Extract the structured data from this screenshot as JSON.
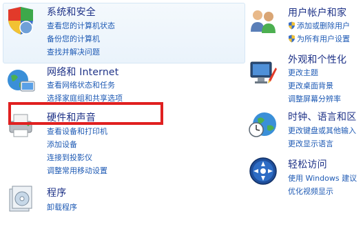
{
  "left": {
    "system": {
      "title": "系统和安全",
      "links": [
        "查看您的计算机状态",
        "备份您的计算机",
        "查找并解决问题"
      ]
    },
    "network": {
      "title": "网络和 Internet",
      "links": [
        "查看网络状态和任务",
        "选择家庭组和共享选项"
      ]
    },
    "hardware": {
      "title": "硬件和声音",
      "links": [
        "查看设备和打印机",
        "添加设备",
        "连接到投影仪",
        "调整常用移动设置"
      ]
    },
    "programs": {
      "title": "程序",
      "links": [
        "卸载程序"
      ]
    }
  },
  "right": {
    "accounts": {
      "title": "用户帐户和家",
      "links": [
        "添加或删除用户",
        "为所有用户设置"
      ]
    },
    "appearance": {
      "title": "外观和个性化",
      "links": [
        "更改主题",
        "更改桌面背景",
        "调整屏幕分辨率"
      ]
    },
    "clock": {
      "title": "时钟、语言和区",
      "links": [
        "更改键盘或其他输入",
        "更改显示语言"
      ]
    },
    "ease": {
      "title": "轻松访问",
      "links": [
        "使用 Windows 建议",
        "优化视频显示"
      ]
    }
  },
  "colors": {
    "title": "#1e3287",
    "link": "#1e5ab4",
    "highlight": "#e02020"
  }
}
